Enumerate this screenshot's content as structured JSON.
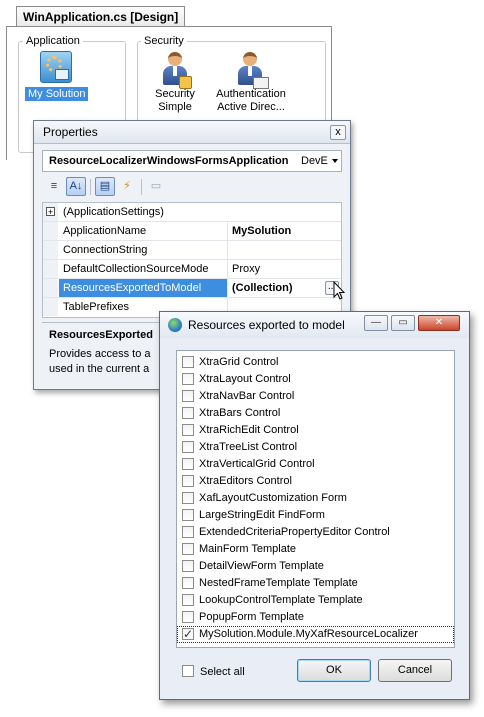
{
  "document": {
    "tab_title": "WinApplication.cs [Design]",
    "groups": [
      {
        "title": "Application",
        "items": [
          {
            "label": "My Solution"
          }
        ]
      },
      {
        "title": "Security",
        "items": [
          {
            "label": "Security\nSimple"
          },
          {
            "label": "Authentication\nActive Direc..."
          }
        ]
      }
    ]
  },
  "properties": {
    "title": "Properties",
    "close_label": "x",
    "object_name": "ResourceLocalizerWindowsFormsApplication",
    "object_type": "DevE",
    "toolbar": {
      "categorized": "≡",
      "alphabetical": "A↓",
      "properties": "▤",
      "events": "⚡",
      "property_pages": "▭"
    },
    "rows": [
      {
        "name": "(ApplicationSettings)",
        "value": "",
        "expander": "+"
      },
      {
        "name": "ApplicationName",
        "value": "MySolution",
        "bold": true
      },
      {
        "name": "ConnectionString",
        "value": ""
      },
      {
        "name": "DefaultCollectionSourceMode",
        "value": "Proxy"
      },
      {
        "name": "ResourcesExportedToModel",
        "value": "(Collection)",
        "bold": true,
        "selected": true,
        "button": "..."
      },
      {
        "name": "TablePrefixes",
        "value": ""
      }
    ],
    "description": {
      "title": "ResourcesExported",
      "text": "Provides access to a used in the current a"
    }
  },
  "dialog": {
    "title": "Resources exported to model",
    "window_buttons": {
      "minimize": "—",
      "maximize": "▭",
      "close": "✕"
    },
    "items": [
      {
        "label": "XtraGrid Control",
        "checked": false
      },
      {
        "label": "XtraLayout Control",
        "checked": false
      },
      {
        "label": "XtraNavBar Control",
        "checked": false
      },
      {
        "label": "XtraBars Control",
        "checked": false
      },
      {
        "label": "XtraRichEdit Control",
        "checked": false
      },
      {
        "label": "XtraTreeList Control",
        "checked": false
      },
      {
        "label": "XtraVerticalGrid Control",
        "checked": false
      },
      {
        "label": "XtraEditors Control",
        "checked": false
      },
      {
        "label": "XafLayoutCustomization Form",
        "checked": false
      },
      {
        "label": "LargeStringEdit FindForm",
        "checked": false
      },
      {
        "label": "ExtendedCriteriaPropertyEditor Control",
        "checked": false
      },
      {
        "label": "MainForm Template",
        "checked": false
      },
      {
        "label": "DetailViewForm Template",
        "checked": false
      },
      {
        "label": "NestedFrameTemplate Template",
        "checked": false
      },
      {
        "label": "LookupControlTemplate Template",
        "checked": false
      },
      {
        "label": "PopupForm Template",
        "checked": false
      },
      {
        "label": "MySolution.Module.MyXafResourceLocalizer",
        "checked": true
      }
    ],
    "select_all": "Select all",
    "ok": "OK",
    "cancel": "Cancel"
  }
}
